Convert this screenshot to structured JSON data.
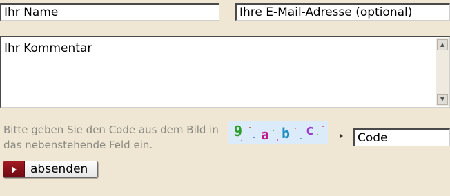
{
  "form": {
    "name_placeholder": "Ihr Name",
    "email_placeholder": "Ihre E-Mail-Adresse (optional)",
    "comment_placeholder": "Ihr Kommentar",
    "captcha_instruction": "Bitte geben Sie den Code aus dem Bild in das nebenstehende Feld ein.",
    "captcha_chars": [
      "9",
      "a",
      "b",
      "c"
    ],
    "code_placeholder": "Code",
    "submit_label": "absenden"
  },
  "colors": {
    "page_background": "#efe6d3",
    "submit_icon_red": "#8b1219",
    "captcha_background": "#dcebfa"
  },
  "icons": {
    "submit": "play-triangle-icon",
    "scroll_up": "scroll-up-arrow-icon",
    "scroll_down": "scroll-down-arrow-icon",
    "field_marker": "right-arrow-marker-icon"
  }
}
